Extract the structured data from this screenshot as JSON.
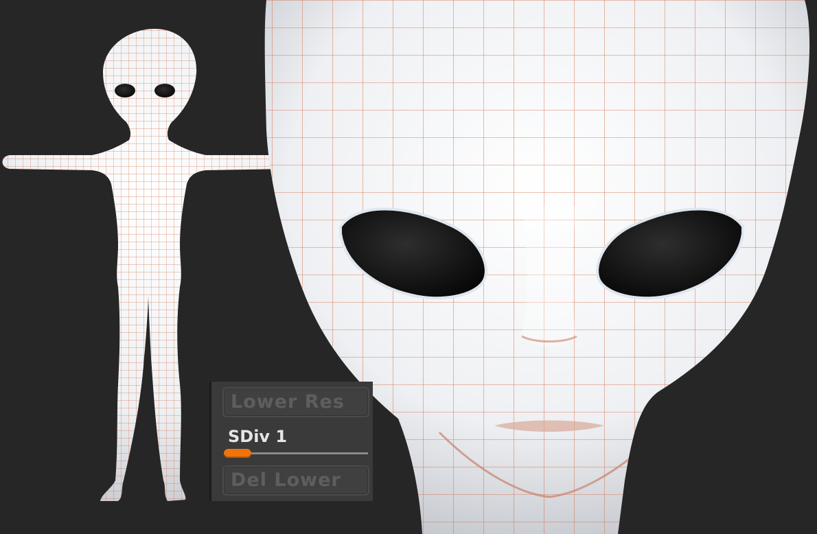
{
  "subdivision_panel": {
    "lower_res_label": "Lower Res",
    "sdiv_label": "SDiv 1",
    "sdiv_level": 1,
    "sdiv_max": 6,
    "del_lower_label": "Del Lower"
  },
  "colors": {
    "background": "#262626",
    "mesh_skin": "#f2f2f4",
    "wireframe": "#d36b45",
    "eye": "#0f0f0f",
    "slider_accent": "#f0730c"
  }
}
